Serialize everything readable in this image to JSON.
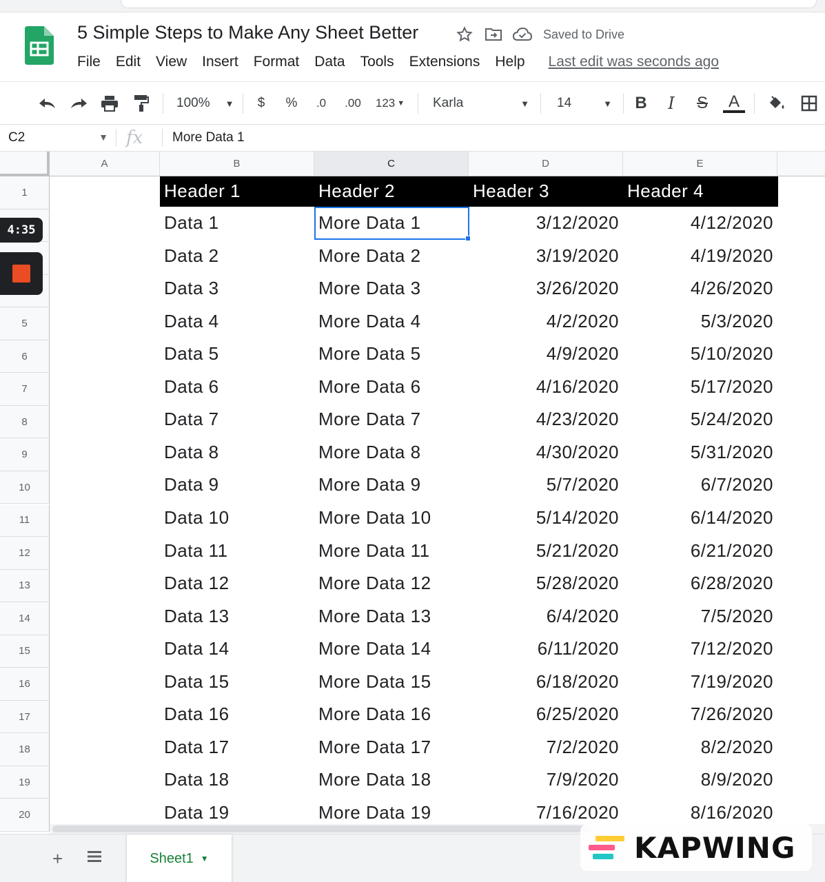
{
  "doc": {
    "title": "5 Simple Steps to Make Any Sheet Better",
    "saved_status": "Saved to Drive",
    "last_edit": "Last edit was seconds ago"
  },
  "menu": [
    "File",
    "Edit",
    "View",
    "Insert",
    "Format",
    "Data",
    "Tools",
    "Extensions",
    "Help"
  ],
  "toolbar": {
    "zoom": "100%",
    "currency": "$",
    "percent": "%",
    "decrease_decimal": ".0",
    "increase_decimal": ".00",
    "more_formats": "123",
    "font": "Karla",
    "font_size": "14",
    "bold": "B",
    "italic": "I",
    "strikethrough": "S",
    "text_color": "A"
  },
  "formula_bar": {
    "cell_ref": "C2",
    "value": "More Data 1"
  },
  "columns": [
    "A",
    "B",
    "C",
    "D",
    "E"
  ],
  "selected_column": "C",
  "row_numbers": [
    "1",
    "",
    "",
    "",
    "5",
    "6",
    "7",
    "8",
    "9",
    "10",
    "11",
    "12",
    "13",
    "14",
    "15",
    "16",
    "17",
    "18",
    "19",
    "20"
  ],
  "headers": [
    "Header 1",
    "Header 2",
    "Header 3",
    "Header 4"
  ],
  "rows": [
    [
      "Data 1",
      "More Data 1",
      "3/12/2020",
      "4/12/2020"
    ],
    [
      "Data 2",
      "More Data 2",
      "3/19/2020",
      "4/19/2020"
    ],
    [
      "Data 3",
      "More Data 3",
      "3/26/2020",
      "4/26/2020"
    ],
    [
      "Data 4",
      "More Data 4",
      "4/2/2020",
      "5/3/2020"
    ],
    [
      "Data 5",
      "More Data 5",
      "4/9/2020",
      "5/10/2020"
    ],
    [
      "Data 6",
      "More Data 6",
      "4/16/2020",
      "5/17/2020"
    ],
    [
      "Data 7",
      "More Data 7",
      "4/23/2020",
      "5/24/2020"
    ],
    [
      "Data 8",
      "More Data 8",
      "4/30/2020",
      "5/31/2020"
    ],
    [
      "Data 9",
      "More Data 9",
      "5/7/2020",
      "6/7/2020"
    ],
    [
      "Data 10",
      "More Data 10",
      "5/14/2020",
      "6/14/2020"
    ],
    [
      "Data 11",
      "More Data 11",
      "5/21/2020",
      "6/21/2020"
    ],
    [
      "Data 12",
      "More Data 12",
      "5/28/2020",
      "6/28/2020"
    ],
    [
      "Data 13",
      "More Data 13",
      "6/4/2020",
      "7/5/2020"
    ],
    [
      "Data 14",
      "More Data 14",
      "6/11/2020",
      "7/12/2020"
    ],
    [
      "Data 15",
      "More Data 15",
      "6/18/2020",
      "7/19/2020"
    ],
    [
      "Data 16",
      "More Data 16",
      "6/25/2020",
      "7/26/2020"
    ],
    [
      "Data 17",
      "More Data 17",
      "7/2/2020",
      "8/2/2020"
    ],
    [
      "Data 18",
      "More Data 18",
      "7/9/2020",
      "8/9/2020"
    ],
    [
      "Data 19",
      "More Data 19",
      "7/16/2020",
      "8/16/2020"
    ]
  ],
  "sheet_tabs": [
    "Sheet1"
  ],
  "overlay": {
    "timer": "4:35",
    "watermark": "KAPWING"
  },
  "colors": {
    "sheets_green": "#188038",
    "selection_blue": "#1a73e8",
    "header_bg": "#000000",
    "header_text": "#ffffff",
    "record_red": "#ea4c24"
  },
  "icons": [
    "sheets-logo-icon",
    "star-icon",
    "move-folder-icon",
    "cloud-saved-icon",
    "undo-icon",
    "redo-icon",
    "print-icon",
    "paint-format-icon",
    "fill-color-icon",
    "borders-icon",
    "add-sheet-icon",
    "all-sheets-icon",
    "stop-record-icon",
    "kapwing-logo-icon"
  ]
}
